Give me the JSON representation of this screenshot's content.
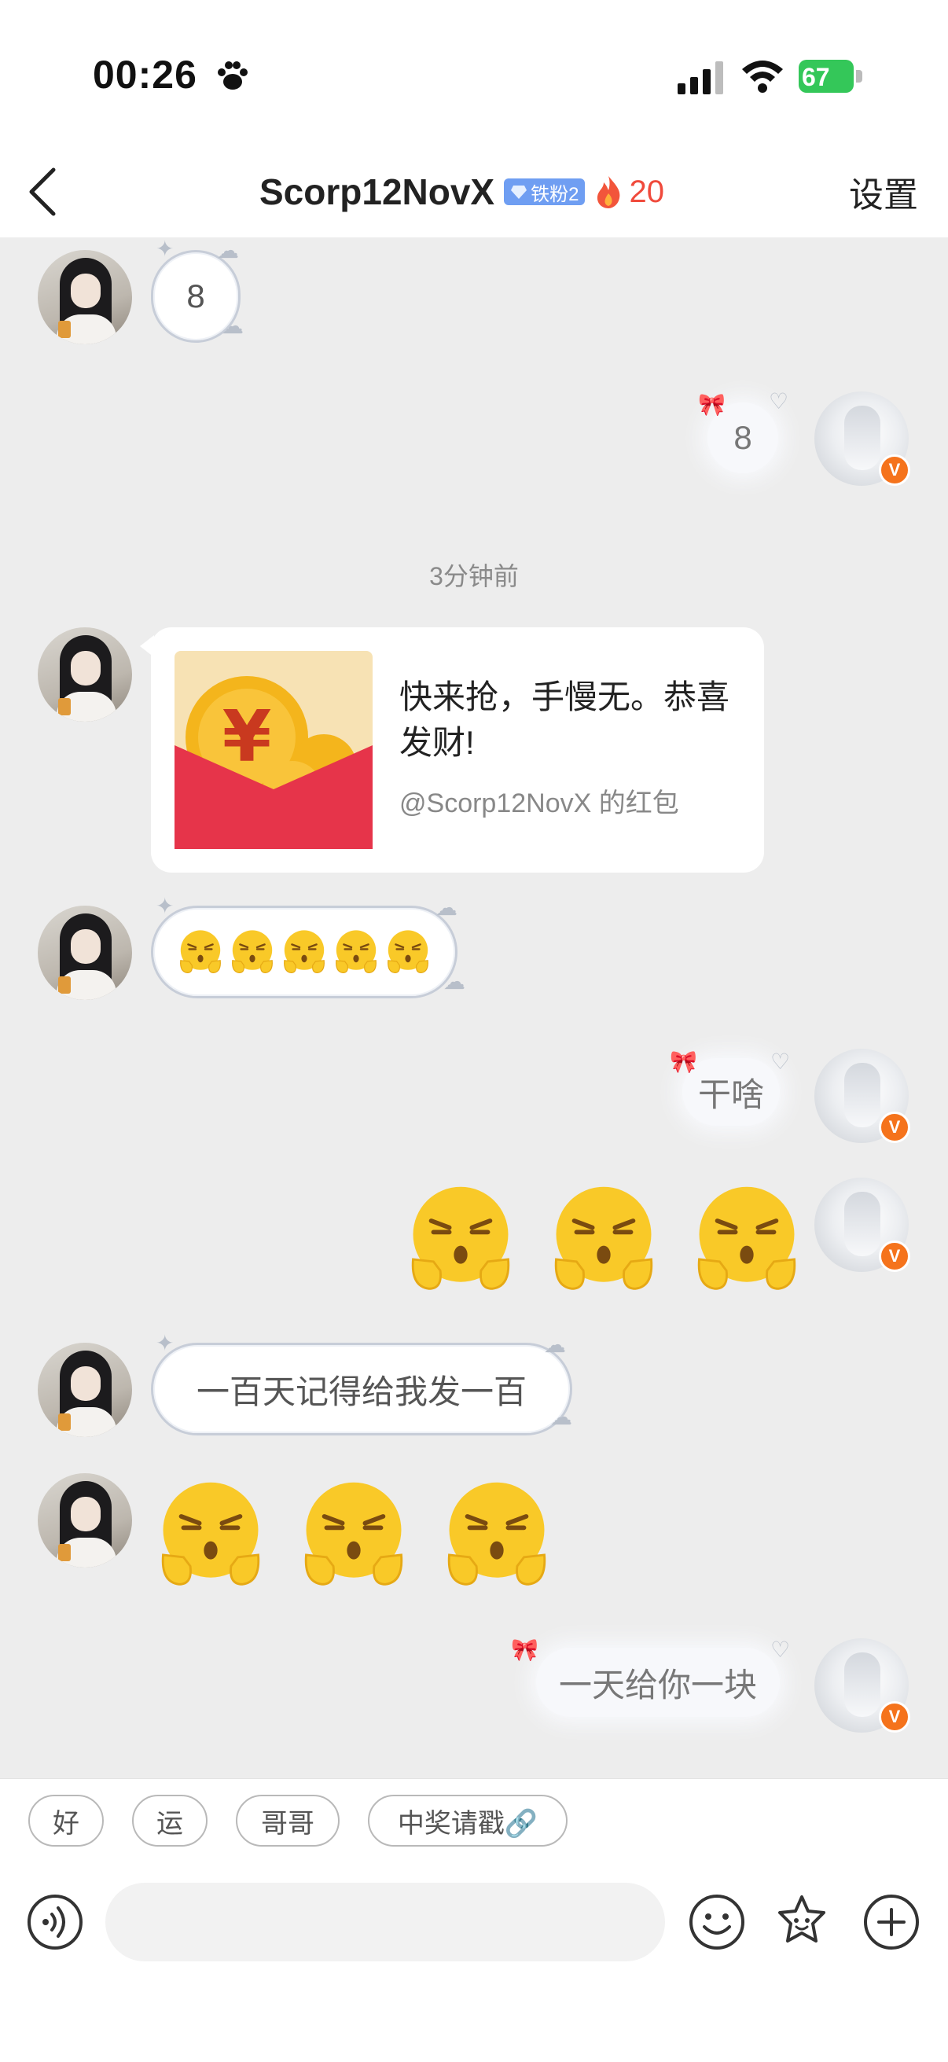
{
  "status_bar": {
    "time": "00:26",
    "battery_percent": "67"
  },
  "nav": {
    "title": "Scorp12NovX",
    "fan_badge": "铁粉2",
    "streak_count": "20",
    "settings_label": "设置"
  },
  "messages": {
    "m1_text": "8",
    "m2_text": "8",
    "timestamp": "3分钟前",
    "red_packet": {
      "title": "快来抢，手慢无。恭喜发财!",
      "subtitle": "@Scorp12NovX 的红包"
    },
    "m4_text": "干啥",
    "m6_text": "一百天记得给我发一百",
    "m8_text": "一天给你一块"
  },
  "quick_replies": [
    "好",
    "运",
    "哥哥",
    "中奖请戳🔗"
  ],
  "toolbar": {
    "icons": [
      "voice-icon",
      "emoji-icon",
      "sticker-icon",
      "plus-icon"
    ]
  },
  "colors": {
    "accent_red": "#f04a3c",
    "vip_orange": "#f5731c",
    "fan_badge_blue": "#6f9ef2",
    "battery_green": "#34c759"
  }
}
